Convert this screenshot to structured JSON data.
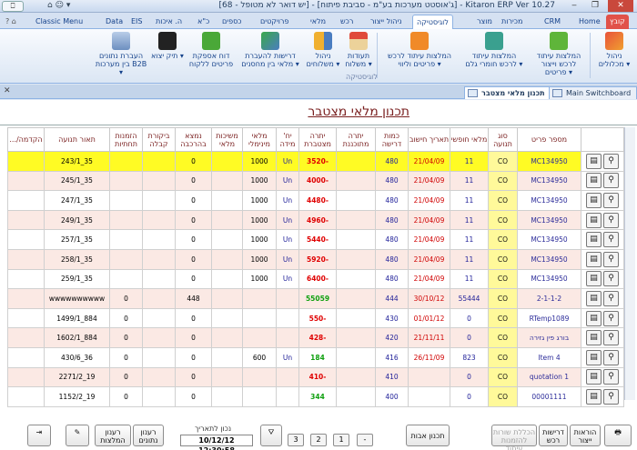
{
  "window": {
    "title": "Kitaron ERP Ver 10.27 - [ג'אוסטט מערכות בע\"מ - סביבת פיתוח] - [יש דואר לא מטופל - 68]",
    "controls": [
      "‒",
      "❐",
      "✕"
    ],
    "quick_access": "⌂  ☺ ▾"
  },
  "ribbon_tabs": [
    "קובץ",
    "Home",
    "CRM",
    "מכירות",
    "מוצר",
    "לוגיסטיקה",
    "ניהול ייצור",
    "רכש",
    "מלאי",
    "פרויקטים",
    "כספים",
    "כ\"א",
    "ה. איכות",
    "EIS",
    "Data",
    "Classic Menu"
  ],
  "ribbon_buttons": [
    {
      "label": "ניהול מכלולים ▾"
    },
    {
      "label": "המלצות עיתוד לרכש וייצור פריטים ▾"
    },
    {
      "label": "המלצות עיתוד לרכש חומרי גלם ▾"
    },
    {
      "label": "המלצות עיתוד לרכש פריטים וליווי ▾"
    },
    {
      "label": "תעודות משלוח ▾"
    },
    {
      "label": "ניהול משלוחים ▾"
    },
    {
      "label": "דרישות להעברת מלאי בין מחסנים ▾"
    },
    {
      "label": "דוח אספקת פריטים ללקוח"
    },
    {
      "label": "תיק יצוא ▾"
    },
    {
      "label": "העברת נתונים בין מערכות B2B ▾"
    }
  ],
  "ribbon_group_label": "לוגיסטיקה",
  "doc_tabs": [
    "תכנון מלאי מצטבר",
    "Main Switchboard"
  ],
  "form": {
    "title": "תכנון מלאי מצטבר",
    "columns": [
      "מספר פריט",
      "סוג תנועה",
      "מלאי חופשי",
      "תאריך חישוב",
      "כמות דרישה",
      "יתרה מתוכננת",
      "יתרה מצטברת",
      "יח' מידה",
      "מלאי מינימלי",
      "משיכות מלאי",
      "נמצא בהרכבה",
      "ביקורת קבלה",
      "הזמנות תחתיות",
      "תאור תנועה",
      "הקדמה/..."
    ]
  },
  "rows": [
    {
      "part": "MC134950",
      "type": "CO",
      "free": "11",
      "date": "21/04/09",
      "req": "480",
      "planned": "",
      "cum": "-3520",
      "uom": "Un",
      "min": "1000",
      "wd": "",
      "asm": "0",
      "insp": "",
      "orders": "",
      "desc": "35_243/1",
      "style": "yellow",
      "sign": "neg"
    },
    {
      "part": "MC134950",
      "type": "CO",
      "free": "11",
      "date": "21/04/09",
      "req": "480",
      "planned": "",
      "cum": "-4000",
      "uom": "Un",
      "min": "1000",
      "wd": "",
      "asm": "0",
      "insp": "",
      "orders": "",
      "desc": "35_245/1",
      "style": "pink",
      "sign": "neg"
    },
    {
      "part": "MC134950",
      "type": "CO",
      "free": "11",
      "date": "21/04/09",
      "req": "480",
      "planned": "",
      "cum": "-4480",
      "uom": "Un",
      "min": "1000",
      "wd": "",
      "asm": "0",
      "insp": "",
      "orders": "",
      "desc": "35_247/1",
      "style": "white",
      "sign": "neg"
    },
    {
      "part": "MC134950",
      "type": "CO",
      "free": "11",
      "date": "21/04/09",
      "req": "480",
      "planned": "",
      "cum": "-4960",
      "uom": "Un",
      "min": "1000",
      "wd": "",
      "asm": "0",
      "insp": "",
      "orders": "",
      "desc": "35_249/1",
      "style": "pink",
      "sign": "neg"
    },
    {
      "part": "MC134950",
      "type": "CO",
      "free": "11",
      "date": "21/04/09",
      "req": "480",
      "planned": "",
      "cum": "-5440",
      "uom": "Un",
      "min": "1000",
      "wd": "",
      "asm": "0",
      "insp": "",
      "orders": "",
      "desc": "35_257/1",
      "style": "white",
      "sign": "neg"
    },
    {
      "part": "MC134950",
      "type": "CO",
      "free": "11",
      "date": "21/04/09",
      "req": "480",
      "planned": "",
      "cum": "-5920",
      "uom": "Un",
      "min": "1000",
      "wd": "",
      "asm": "0",
      "insp": "",
      "orders": "",
      "desc": "35_258/1",
      "style": "pink",
      "sign": "neg"
    },
    {
      "part": "MC134950",
      "type": "CO",
      "free": "11",
      "date": "21/04/09",
      "req": "480",
      "planned": "",
      "cum": "-6400",
      "uom": "Un",
      "min": "1000",
      "wd": "",
      "asm": "0",
      "insp": "",
      "orders": "",
      "desc": "35_259/1",
      "style": "white",
      "sign": "neg"
    },
    {
      "part": "2-1-1-2",
      "type": "CO",
      "free": "55444",
      "date": "30/10/12",
      "req": "444",
      "planned": "",
      "cum": "55059",
      "uom": "",
      "min": "",
      "wd": "",
      "asm": "448",
      "insp": "",
      "orders": "0",
      "desc": "wwwwwwwwww",
      "style": "pink",
      "sign": "pos"
    },
    {
      "part": "RTemp1089",
      "type": "CO",
      "free": "0",
      "date": "01/01/12",
      "req": "430",
      "planned": "",
      "cum": "-550",
      "uom": "",
      "min": "",
      "wd": "",
      "asm": "0",
      "insp": "",
      "orders": "0",
      "desc": "884_1499/1",
      "style": "white",
      "sign": "neg"
    },
    {
      "part": "בורג פין גזירה",
      "type": "CO",
      "free": "0",
      "date": "21/11/11",
      "req": "420",
      "planned": "",
      "cum": "-428",
      "uom": "",
      "min": "",
      "wd": "",
      "asm": "0",
      "insp": "",
      "orders": "0",
      "desc": "884_1602/1",
      "style": "pink",
      "sign": "neg"
    },
    {
      "part": "Item 4",
      "type": "CO",
      "free": "823",
      "date": "26/11/09",
      "req": "416",
      "planned": "",
      "cum": "184",
      "uom": "Un",
      "min": "600",
      "wd": "",
      "asm": "0",
      "insp": "",
      "orders": "0",
      "desc": "36_430/6",
      "style": "white",
      "sign": "pos"
    },
    {
      "part": "quotation 1",
      "type": "CO",
      "free": "0",
      "date": "",
      "req": "410",
      "planned": "",
      "cum": "-410",
      "uom": "",
      "min": "",
      "wd": "",
      "asm": "0",
      "insp": "",
      "orders": "0",
      "desc": "19_2271/2",
      "style": "pink",
      "sign": "neg"
    },
    {
      "part": "00001111",
      "type": "CO",
      "free": "0",
      "date": "",
      "req": "400",
      "planned": "",
      "cum": "344",
      "uom": "",
      "min": "",
      "wd": "",
      "asm": "0",
      "insp": "",
      "orders": "0",
      "desc": "19_1152/2",
      "style": "white",
      "sign": "pos"
    }
  ],
  "bottom": {
    "production_orders": "הוראות ייצור",
    "purchase_requests": "דרישות רכש",
    "scheduling_lines": "הכללת שורות להזמנות עיתוד",
    "plan_parents": "תכנון אבות",
    "pages": [
      "-",
      "1",
      "2",
      "3"
    ],
    "filter_icon": "filter-icon",
    "date_label": "נכון לתאריך",
    "date_value": "10/12/12 12:30:58",
    "refresh_data": "רענון נתונים",
    "refresh_recs": "רענון המלצות",
    "print_icon": "print-icon",
    "exit_icon": "exit-icon",
    "edit_icon": "edit-icon"
  },
  "colors": {
    "yellow_row": "#fffb24",
    "pink_row": "#fbe9e4",
    "negative": "#e00000",
    "positive": "#10a010",
    "header_text": "#7a2020"
  }
}
